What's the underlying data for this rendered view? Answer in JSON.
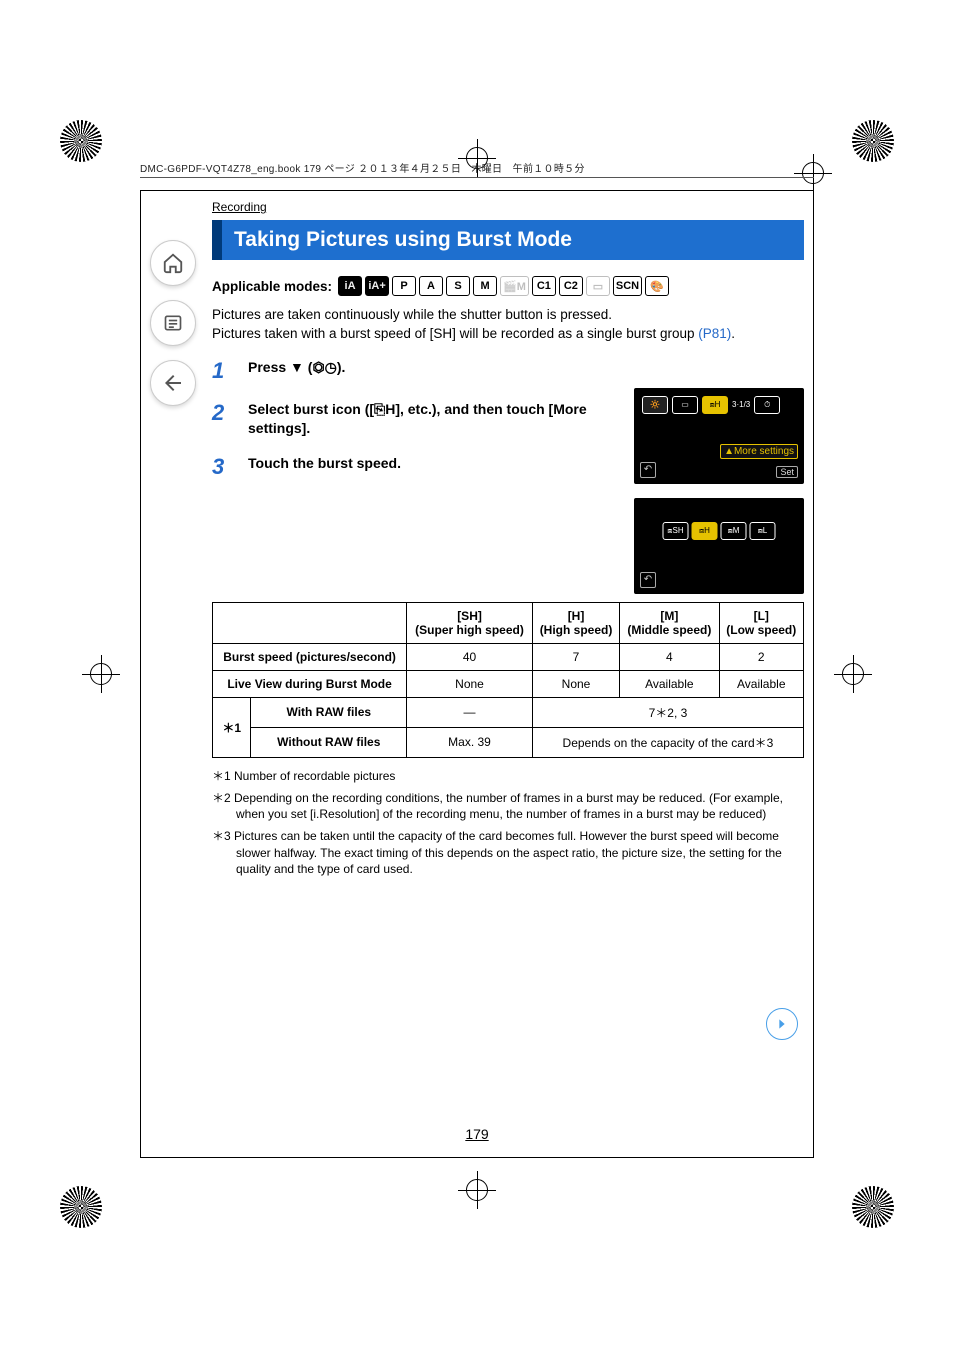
{
  "runhead": "DMC-G6PDF-VQT4Z78_eng.book   179 ページ   ２０１３年４月２５日　木曜日　午前１０時５分",
  "section_label": "Recording",
  "title": "Taking Pictures using Burst Mode",
  "modes_label": "Applicable modes:",
  "mode_icons": [
    {
      "label": "iA",
      "filled": true,
      "dim": false
    },
    {
      "label": "iA+",
      "filled": true,
      "dim": false
    },
    {
      "label": "P",
      "filled": false,
      "dim": false
    },
    {
      "label": "A",
      "filled": false,
      "dim": false
    },
    {
      "label": "S",
      "filled": false,
      "dim": false
    },
    {
      "label": "M",
      "filled": false,
      "dim": false
    },
    {
      "label": "🎬M",
      "filled": false,
      "dim": true
    },
    {
      "label": "C1",
      "filled": false,
      "dim": false
    },
    {
      "label": "C2",
      "filled": false,
      "dim": false
    },
    {
      "label": "▭",
      "filled": false,
      "dim": true
    },
    {
      "label": "SCN",
      "filled": false,
      "dim": false
    },
    {
      "label": "🎨",
      "filled": false,
      "dim": false
    }
  ],
  "intro_line1": "Pictures are taken continuously while the shutter button is pressed.",
  "intro_line2_a": "Pictures taken with a burst speed of [SH] will be recorded as a single burst group ",
  "intro_line2_link": "(P81)",
  "intro_line2_b": ".",
  "steps": [
    {
      "n": "1",
      "text": "Press ▼ (⏣◷)."
    },
    {
      "n": "2",
      "text": "Select burst icon ([⎘H], etc.), and then touch [More settings]."
    },
    {
      "n": "3",
      "text": "Touch the burst speed."
    }
  ],
  "screens": {
    "top": {
      "badge1": "🔆",
      "badge2": "▭",
      "sel": "⧈H",
      "text": "3·1/3",
      "timer": "⏱",
      "more": "▲More settings",
      "set": "Set"
    },
    "bottom": {
      "opts": [
        "⧈SH",
        "⧈H",
        "⧈M",
        "⧈L"
      ]
    }
  },
  "table": {
    "headers": [
      "",
      "[SH]\n(Super high speed)",
      "[H]\n(High speed)",
      "[M]\n(Middle speed)",
      "[L]\n(Low speed)"
    ],
    "rows": [
      {
        "label": "Burst speed (pictures/second)",
        "cells": [
          "40",
          "7",
          "4",
          "2"
        ]
      },
      {
        "label": "Live View during Burst Mode",
        "cells": [
          "None",
          "None",
          "Available",
          "Available"
        ]
      }
    ],
    "rawgroup": {
      "star": "＊1",
      "row1": {
        "label": "With RAW files",
        "c1": "—",
        "c2": "7＊2, 3"
      },
      "row2": {
        "label": "Without RAW files",
        "c1": "Max. 39",
        "c2": "Depends on the capacity of the card＊3"
      }
    }
  },
  "footnotes": [
    "＊1 Number of recordable pictures",
    "＊2 Depending on the recording conditions, the number of frames in a burst may be reduced. (For example, when you set [i.Resolution] of the recording menu, the number of frames in a burst may be reduced)",
    "＊3 Pictures can be taken until the capacity of the card becomes full. However the burst speed will become slower halfway. The exact timing of this depends on the aspect ratio, the picture size, the setting for the quality and the type of card used."
  ],
  "page_number": "179"
}
